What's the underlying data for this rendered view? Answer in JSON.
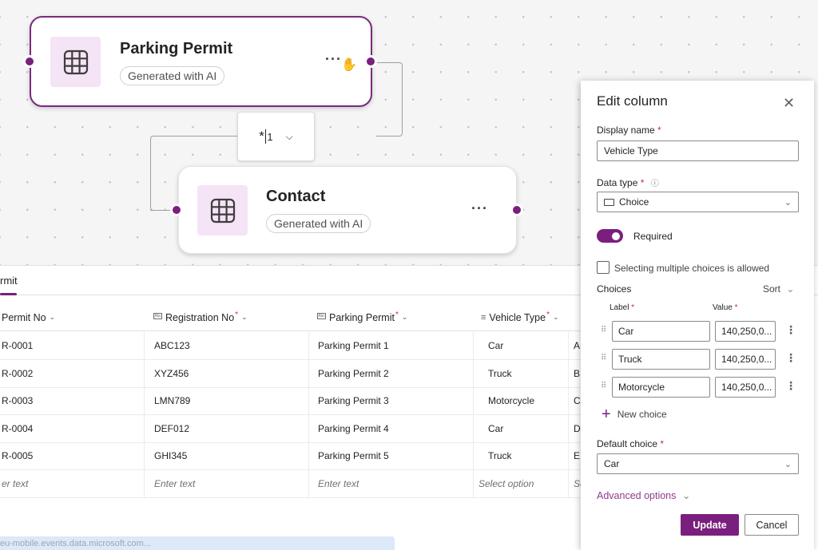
{
  "canvas": {
    "nodes": [
      {
        "title": "Parking Permit",
        "badge": "Generated with AI",
        "more": "···",
        "icon": "table-icon",
        "selected": true
      },
      {
        "title": "Contact",
        "badge": "Generated with AI",
        "more": "···",
        "icon": "table-icon",
        "selected": false
      }
    ],
    "relationship": {
      "many": "*",
      "one": "1",
      "chevron": "⌄"
    }
  },
  "tabs": [
    {
      "label": "rmit",
      "active": true
    }
  ],
  "grid": {
    "columns": [
      {
        "label": "Permit No",
        "required": false,
        "icon": ""
      },
      {
        "label": "Registration No",
        "required": true,
        "icon": "text-field-icon"
      },
      {
        "label": "Parking Permit",
        "required": true,
        "icon": "text-field-icon"
      },
      {
        "label": "Vehicle Type",
        "required": true,
        "icon": "choice-list-icon"
      },
      {
        "label": "",
        "required": false,
        "icon": ""
      }
    ],
    "rows": [
      [
        "R-0001",
        "ABC123",
        "Parking Permit 1",
        "Car",
        "A"
      ],
      [
        "R-0002",
        "XYZ456",
        "Parking Permit 2",
        "Truck",
        "B"
      ],
      [
        "R-0003",
        "LMN789",
        "Parking Permit 3",
        "Motorcycle",
        "C"
      ],
      [
        "R-0004",
        "DEF012",
        "Parking Permit 4",
        "Car",
        "D"
      ],
      [
        "R-0005",
        "GHI345",
        "Parking Permit 5",
        "Truck",
        "E"
      ]
    ],
    "new_row": [
      "er text",
      "Enter text",
      "Enter text",
      "Select option",
      "Se"
    ]
  },
  "status_url": "eu-mobile.events.data.microsoft.com...",
  "panel": {
    "title": "Edit column",
    "close": "✕",
    "display_name_label": "Display name",
    "display_name_value": "Vehicle Type",
    "data_type_label": "Data type",
    "data_type_value": "Choice",
    "required_label": "Required",
    "required_on": true,
    "multi_label": "Selecting multiple choices is allowed",
    "multi_checked": false,
    "choices_label": "Choices",
    "sort_label": "Sort",
    "label_header": "Label",
    "value_header": "Value",
    "choices": [
      {
        "label": "Car",
        "value": "140,250,0..."
      },
      {
        "label": "Truck",
        "value": "140,250,0..."
      },
      {
        "label": "Motorcycle",
        "value": "140,250,0..."
      }
    ],
    "new_choice": "New choice",
    "default_choice_label": "Default choice",
    "default_choice_value": "Car",
    "advanced_label": "Advanced options",
    "update_label": "Update",
    "cancel_label": "Cancel",
    "required_mark": "*"
  },
  "colors": {
    "accent": "#7a1f7e",
    "icon_bg": "#f5e3f6",
    "required": "#c4314b"
  }
}
